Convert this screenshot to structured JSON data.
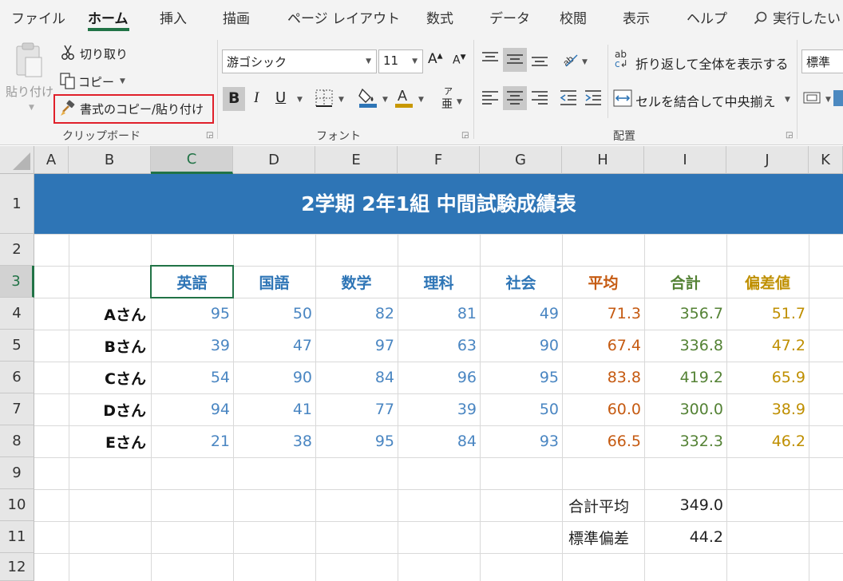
{
  "tabs": [
    "ファイル",
    "ホーム",
    "挿入",
    "描画",
    "ページ レイアウト",
    "数式",
    "データ",
    "校閲",
    "表示",
    "ヘルプ"
  ],
  "search_label": "実行したい",
  "clipboard": {
    "paste": "貼り付け",
    "cut": "切り取り",
    "copy": "コピー",
    "format_painter": "書式のコピー/貼り付け",
    "group_label": "クリップボード"
  },
  "font": {
    "name": "游ゴシック",
    "size": "11",
    "grow": "A",
    "shrink": "A",
    "bold": "B",
    "italic": "I",
    "underline": "U",
    "phonetic_top": "ア",
    "phonetic_bottom": "亜",
    "group_label": "フォント"
  },
  "alignment": {
    "wrap_text": "折り返して全体を表示する",
    "merge_center": "セルを結合して中央揃え",
    "wrap_icon_text": "ab",
    "wrap_icon_c": "c",
    "group_label": "配置"
  },
  "number": {
    "format": "標準"
  },
  "columns": [
    "A",
    "B",
    "C",
    "D",
    "E",
    "F",
    "G",
    "H",
    "I",
    "J",
    "K"
  ],
  "rows": [
    "1",
    "2",
    "3",
    "4",
    "5",
    "6",
    "7",
    "8",
    "9",
    "10",
    "11",
    "12"
  ],
  "sheet": {
    "title": "2学期 2年1組 中間試験成績表",
    "headers": [
      "英語",
      "国語",
      "数学",
      "理科",
      "社会",
      "平均",
      "合計",
      "偏差値"
    ],
    "students": [
      {
        "name": "Aさん",
        "scores": [
          "95",
          "50",
          "82",
          "81",
          "49"
        ],
        "avg": "71.3",
        "total": "356.7",
        "dev": "51.7"
      },
      {
        "name": "Bさん",
        "scores": [
          "39",
          "47",
          "97",
          "63",
          "90"
        ],
        "avg": "67.4",
        "total": "336.8",
        "dev": "47.2"
      },
      {
        "name": "Cさん",
        "scores": [
          "54",
          "90",
          "84",
          "96",
          "95"
        ],
        "avg": "83.8",
        "total": "419.2",
        "dev": "65.9"
      },
      {
        "name": "Dさん",
        "scores": [
          "94",
          "41",
          "77",
          "39",
          "50"
        ],
        "avg": "60.0",
        "total": "300.0",
        "dev": "38.9"
      },
      {
        "name": "Eさん",
        "scores": [
          "21",
          "38",
          "95",
          "84",
          "93"
        ],
        "avg": "66.5",
        "total": "332.3",
        "dev": "46.2"
      }
    ],
    "summary": [
      {
        "label": "合計平均",
        "value": "349.0"
      },
      {
        "label": "標準偏差",
        "value": "44.2"
      }
    ]
  },
  "colors": {
    "excel_green": "#217346",
    "title_band": "#2e75b6",
    "subject_blue": "#2e75b6",
    "score_blue": "#4a86c2",
    "avg_orange": "#c55a11",
    "total_green": "#548235",
    "dev_gold": "#bf8f00",
    "highlight_red": "#e0202a"
  }
}
